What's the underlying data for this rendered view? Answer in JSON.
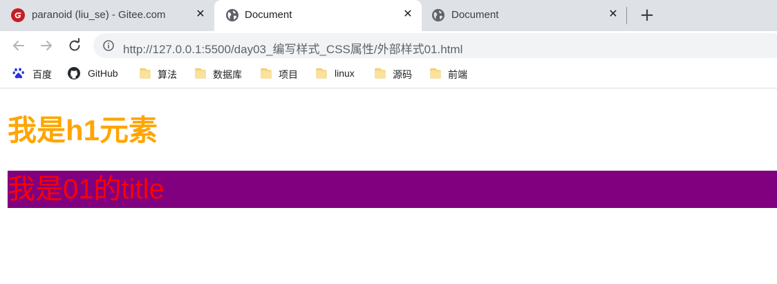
{
  "tabs": [
    {
      "title": "paranoid (liu_se) - Gitee.com",
      "favicon": "gitee-icon",
      "active": false
    },
    {
      "title": "Document",
      "favicon": "globe-icon",
      "active": true
    },
    {
      "title": "Document",
      "favicon": "globe-icon",
      "active": false
    }
  ],
  "tab_close_glyph": "✕",
  "new_tab_glyph": "+",
  "address_bar": {
    "url": "http://127.0.0.1:5500/day03_编写样式_CSS属性/外部样式01.html"
  },
  "bookmarks": [
    {
      "label": "百度",
      "icon": "baidu-icon"
    },
    {
      "label": "GitHub",
      "icon": "github-icon"
    },
    {
      "label": "算法",
      "icon": "folder-icon"
    },
    {
      "label": "数据库",
      "icon": "folder-icon"
    },
    {
      "label": "项目",
      "icon": "folder-icon"
    },
    {
      "label": "linux",
      "icon": "folder-icon"
    },
    {
      "label": "源码",
      "icon": "folder-icon"
    },
    {
      "label": "前端",
      "icon": "folder-icon"
    }
  ],
  "content": {
    "h1": "我是h1元素",
    "title_text": "我是01的title"
  },
  "colors": {
    "h1": "#ffa500",
    "title_text": "#ff0000",
    "title_background": "#800080",
    "gitee_brand": "#c71d23"
  }
}
